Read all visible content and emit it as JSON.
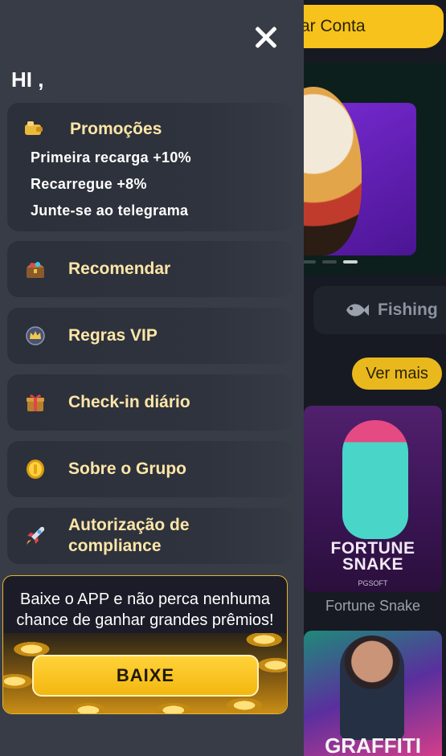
{
  "background": {
    "top_button_label": "ar Conta",
    "tab_label": "Fishing",
    "see_more_label": "Ver mais",
    "game1": {
      "art_title_line1": "FORTUNE",
      "art_title_line2": "SNAKE",
      "art_brand": "PGSOFT",
      "label": "Fortune Snake"
    },
    "game2": {
      "art_title": "GRAFFITI"
    },
    "banner": {
      "dots": 3,
      "active_dot": 3
    }
  },
  "drawer": {
    "greeting": "HI ,",
    "promotions": {
      "title": "Promoções",
      "items": [
        "Primeira recarga +10%",
        "Recarregue +8%",
        "Junte-se ao telegrama"
      ]
    },
    "menu": [
      {
        "label": "Recomendar",
        "icon": "treasure-chest-icon"
      },
      {
        "label": "Regras VIP",
        "icon": "vip-crown-icon"
      },
      {
        "label": "Check-in diário",
        "icon": "gift-box-icon"
      },
      {
        "label": "Sobre o Grupo",
        "icon": "gold-coin-icon"
      },
      {
        "label": "Autorização de\ncompliance",
        "icon": "rocket-icon"
      }
    ],
    "download": {
      "text": "Baixe o APP e não perca nenhuma chance de ganhar grandes prêmios!",
      "button_label": "BAIXE"
    }
  },
  "colors": {
    "drawer_bg": "#383c47",
    "panel_bg": "#2f333d",
    "menu_text": "#fde6a8",
    "accent_yellow": "#f6c21b"
  }
}
